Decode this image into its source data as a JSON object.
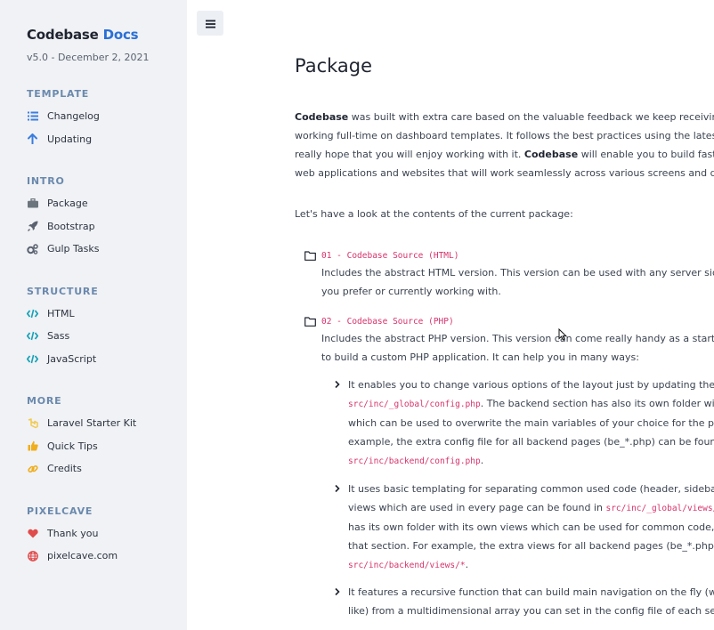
{
  "sidebar": {
    "brand_name": "Codebase",
    "brand_accent": "Docs",
    "version": "v5.0 - December 2, 2021",
    "sections": [
      {
        "heading": "TEMPLATE",
        "items": [
          {
            "label": "Changelog",
            "icon": "list-icon"
          },
          {
            "label": "Updating",
            "icon": "arrow-up-icon"
          }
        ]
      },
      {
        "heading": "INTRO",
        "items": [
          {
            "label": "Package",
            "icon": "briefcase-icon"
          },
          {
            "label": "Bootstrap",
            "icon": "rocket-icon"
          },
          {
            "label": "Gulp Tasks",
            "icon": "cogs-icon"
          }
        ]
      },
      {
        "heading": "STRUCTURE",
        "items": [
          {
            "label": "HTML",
            "icon": "code-icon"
          },
          {
            "label": "Sass",
            "icon": "code-icon"
          },
          {
            "label": "JavaScript",
            "icon": "code-icon"
          }
        ]
      },
      {
        "heading": "MORE",
        "items": [
          {
            "label": "Laravel Starter Kit",
            "icon": "laravel-icon"
          },
          {
            "label": "Quick Tips",
            "icon": "thumbs-up-icon"
          },
          {
            "label": "Credits",
            "icon": "link-icon"
          }
        ]
      },
      {
        "heading": "PIXELCAVE",
        "items": [
          {
            "label": "Thank you",
            "icon": "heart-icon"
          },
          {
            "label": "pixelcave.com",
            "icon": "globe-icon"
          }
        ]
      }
    ]
  },
  "main": {
    "title": "Package",
    "intro": {
      "line1_strong": "Codebase",
      "line1_rest": " was built with extra care based on the valuable feedback we keep receiving o",
      "line2": "working full-time on dashboard templates. It follows the best practices using the latest ",
      "line3_pre": "really hope that you will enjoy working with it. ",
      "line3_strong": "Codebase",
      "line3_rest": " will enable you to build fast, b",
      "line4": "web applications and websites that will work seamlessly across various screens and dev"
    },
    "lead": "Let's have a look at the contents of the current package:",
    "items": [
      {
        "title": "01 - Codebase Source (HTML)",
        "lines": [
          "Includes the abstract HTML version. This version can be used with any server side",
          "you prefer or currently working with."
        ]
      },
      {
        "title": "02 - Codebase Source (PHP)",
        "lines": [
          "Includes the abstract PHP version. This version can come really handy as a startin",
          "to build a custom PHP application. It can help you in many ways:"
        ]
      }
    ],
    "bullets": {
      "b1_l1": "It enables you to change various options of the layout just by updating the m",
      "b1_code1": "src/inc/_global/config.php",
      "b1_l2_rest": ". The backend section has also its own folder wit",
      "b1_l3": "which can be used to overwrite the main variables of your choice for the page",
      "b1_l4": "example, the extra config file for all backend pages (be_*.php) can be found i",
      "b1_code2": "src/inc/backend/config.php",
      "b1_code2_rest": ".",
      "b2_l1": "It uses basic templating for separating common used code (header, sidebar, f",
      "b2_l2_pre": "views which are used in every page can be found in ",
      "b2_code1": "src/inc/_global/views/*",
      "b2_l3": "has its own folder with its own views which can be used for common code, u",
      "b2_l4": "that section. For example, the extra views for all backend pages (be_*.php) ca",
      "b2_code2": "src/inc/backend/views/*",
      "b2_code2_rest": ".",
      "b3_l1": "It features a recursive function that can build main navigation on the fly (with",
      "b3_l2": "like) from a multidimensional array you can set in the config file of each sectio"
    }
  }
}
